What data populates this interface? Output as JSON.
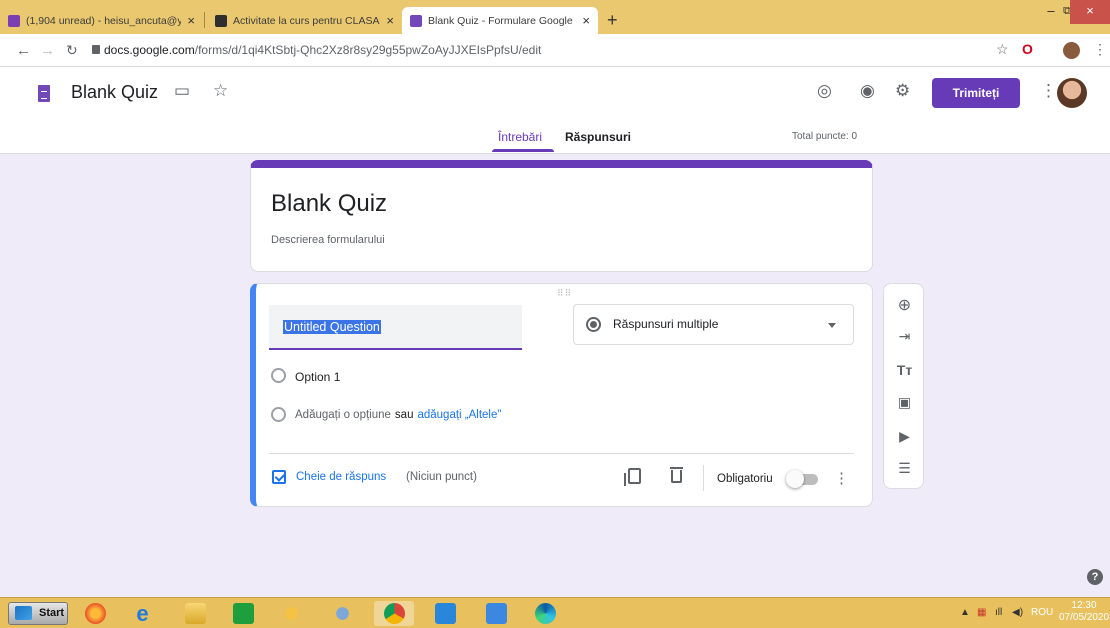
{
  "browser": {
    "tabs": [
      {
        "title": "(1,904 unread) - heisu_ancuta@y",
        "favicon_color": "#7b3fb3",
        "active": false
      },
      {
        "title": "Activitate la curs pentru CLASA A",
        "favicon_color": "#2f2f2f",
        "active": false
      },
      {
        "title": "Blank Quiz - Formulare Google",
        "favicon_color": "#7248b9",
        "active": true
      }
    ],
    "new_tab_label": "+",
    "url_host": "docs.google.com",
    "url_path": "/forms/d/1qi4KtSbtj-Qhc2Xz8r8sy29g55pwZoAyJJXEIsPpfsU/edit",
    "window_controls": {
      "minimize": "–",
      "restore": "⧉",
      "close": "×"
    }
  },
  "forms_header": {
    "doc_title": "Blank Quiz",
    "send_label": "Trimiteți",
    "tabs": {
      "questions": "Întrebări",
      "responses": "Răspunsuri"
    },
    "total_points": "Total puncte: 0"
  },
  "form": {
    "title": "Blank Quiz",
    "description": "Descrierea formularului",
    "accent": "#673ab7"
  },
  "question": {
    "title": "Untitled Question",
    "type_label": "Răspunsuri multiple",
    "option_1": "Option 1",
    "add_option": "Adăugați o opțiune",
    "or_label": "sau",
    "add_other": "adăugați „Altele\"",
    "answer_key_label": "Cheie de răspuns",
    "points_label": "(Niciun punct)",
    "required_label": "Obligatoriu",
    "required_on": false
  },
  "toolbar": {
    "items": [
      "add-question-icon",
      "import-questions-icon",
      "add-title-icon",
      "add-image-icon",
      "add-video-icon",
      "add-section-icon"
    ]
  },
  "taskbar": {
    "start_label": "Start",
    "apps": [
      "firefox",
      "internet-explorer",
      "file-explorer",
      "store",
      "paint",
      "paint-brush",
      "chrome",
      "notepad",
      "word",
      "edge"
    ],
    "language": "ROU",
    "time": "12:30",
    "date": "07/05/2020"
  }
}
